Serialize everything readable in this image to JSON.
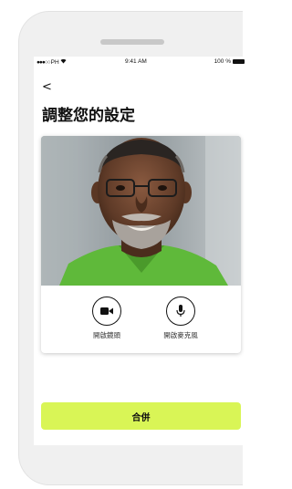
{
  "status_bar": {
    "carrier": "PH",
    "time": "9:41 AM",
    "battery": "100 %"
  },
  "nav": {
    "back_glyph": "<"
  },
  "page": {
    "title": "調整您的設定"
  },
  "controls": {
    "camera": {
      "icon": "video-camera-icon",
      "label": "開啟鏡頭"
    },
    "microphone": {
      "icon": "microphone-icon",
      "label": "開啟麥克風"
    }
  },
  "actions": {
    "merge_label": "合併"
  },
  "colors": {
    "accent": "#d9f556",
    "text": "#111111",
    "shirt": "#5fb93a"
  }
}
